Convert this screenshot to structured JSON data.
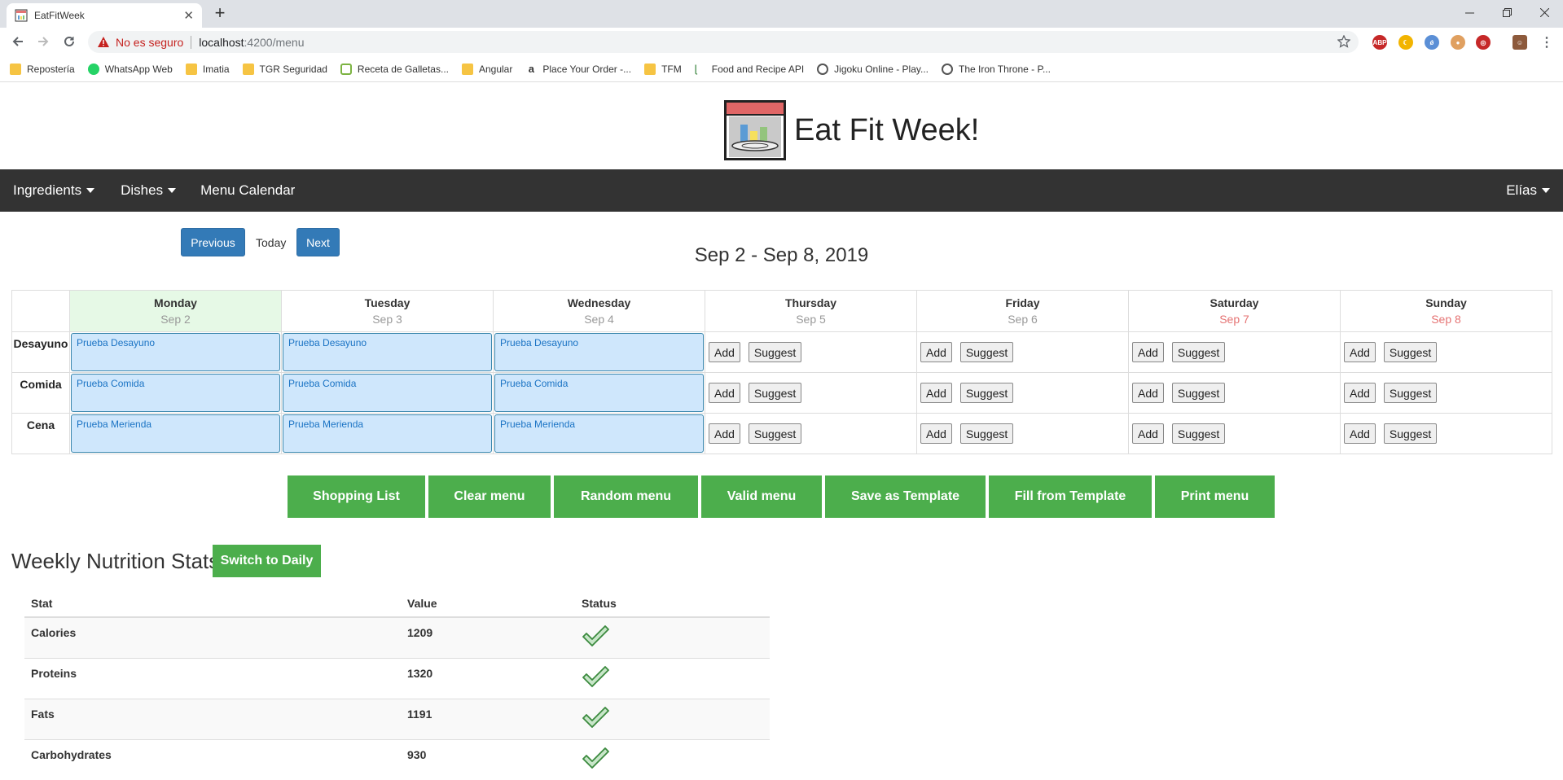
{
  "browser": {
    "tab_title": "EatFitWeek",
    "new_tab": "+",
    "security_label": "No es seguro",
    "url_host": "localhost",
    "url_path": ":4200/menu",
    "bookmarks": [
      "Repostería",
      "WhatsApp Web",
      "Imatia",
      "TGR Seguridad",
      "Receta de Galletas...",
      "Angular",
      "Place Your Order -...",
      "TFM",
      "Food and Recipe API",
      "Jigoku Online - Play...",
      "The Iron Throne - P..."
    ]
  },
  "header": {
    "title": "Eat Fit Week!"
  },
  "nav": {
    "ingredients": "Ingredients",
    "dishes": "Dishes",
    "calendar": "Menu Calendar",
    "user": "Elías"
  },
  "calendar": {
    "previous": "Previous",
    "today": "Today",
    "next": "Next",
    "range": "Sep 2 - Sep 8, 2019",
    "days": [
      {
        "name": "Monday",
        "date": "Sep 2"
      },
      {
        "name": "Tuesday",
        "date": "Sep 3"
      },
      {
        "name": "Wednesday",
        "date": "Sep 4"
      },
      {
        "name": "Thursday",
        "date": "Sep 5"
      },
      {
        "name": "Friday",
        "date": "Sep 6"
      },
      {
        "name": "Saturday",
        "date": "Sep 7"
      },
      {
        "name": "Sunday",
        "date": "Sep 8"
      }
    ],
    "meals": [
      "Desayuno",
      "Comida",
      "Cena"
    ],
    "entries": {
      "desayuno": "Prueba Desayuno",
      "comida": "Prueba Comida",
      "cena": "Prueba Merienda"
    },
    "add_label": "Add",
    "suggest_label": "Suggest"
  },
  "actions": [
    "Shopping List",
    "Clear menu",
    "Random menu",
    "Valid menu",
    "Save as Template",
    "Fill from Template",
    "Print menu"
  ],
  "stats": {
    "title": "Weekly Nutrition Stats",
    "switch": "Switch to Daily",
    "headers": [
      "Stat",
      "Value",
      "Status"
    ],
    "rows": [
      {
        "stat": "Calories",
        "value": "1209"
      },
      {
        "stat": "Proteins",
        "value": "1320"
      },
      {
        "stat": "Fats",
        "value": "1191"
      },
      {
        "stat": "Carbohydrates",
        "value": "930"
      }
    ]
  },
  "colors": {
    "nav_bg": "#333333",
    "primary": "#337ab7",
    "success": "#4cae4c",
    "meal_bg": "#cfe7fc",
    "today_bg": "#e6f9e6",
    "weekend_date": "#e57373"
  }
}
